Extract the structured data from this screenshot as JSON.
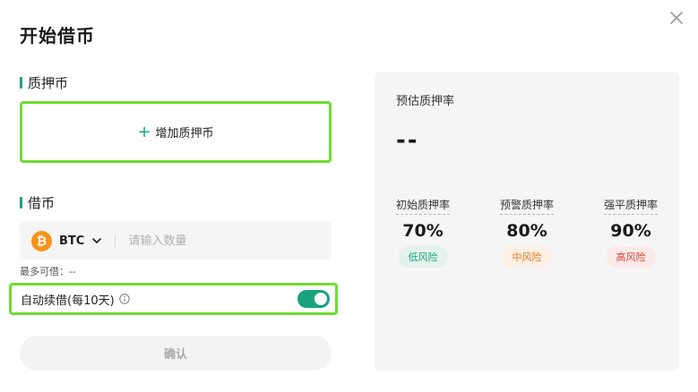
{
  "dialog": {
    "title": "开始借币"
  },
  "collateral": {
    "label": "质押币",
    "add_label": "增加质押币",
    "plus_glyph": "+"
  },
  "borrow": {
    "label": "借币",
    "coin": "BTC",
    "coin_glyph": "₿",
    "coin_color": "#f7931a",
    "amount_placeholder": "请输入数量",
    "max_borrowable": "最多可借：--"
  },
  "auto_renew": {
    "label": "自动续借(每10天)",
    "enabled": true
  },
  "confirm_label": "确认",
  "ratio_panel": {
    "title": "预估质押率",
    "value": "--",
    "rates": [
      {
        "label": "初始质押率",
        "value": "70%",
        "risk": "低风险",
        "color": "#1aa27f"
      },
      {
        "label": "预警质押率",
        "value": "80%",
        "risk": "中风险",
        "color": "#e0761d"
      },
      {
        "label": "强平质押率",
        "value": "90%",
        "risk": "高风险",
        "color": "#d6433b"
      }
    ]
  },
  "colors": {
    "accent": "#1aa27f",
    "highlight_border": "#6fdc2f"
  },
  "icons": {
    "close": "close-icon",
    "chevron": "chevron-down-icon",
    "info": "info-icon",
    "coin": "btc-icon"
  }
}
